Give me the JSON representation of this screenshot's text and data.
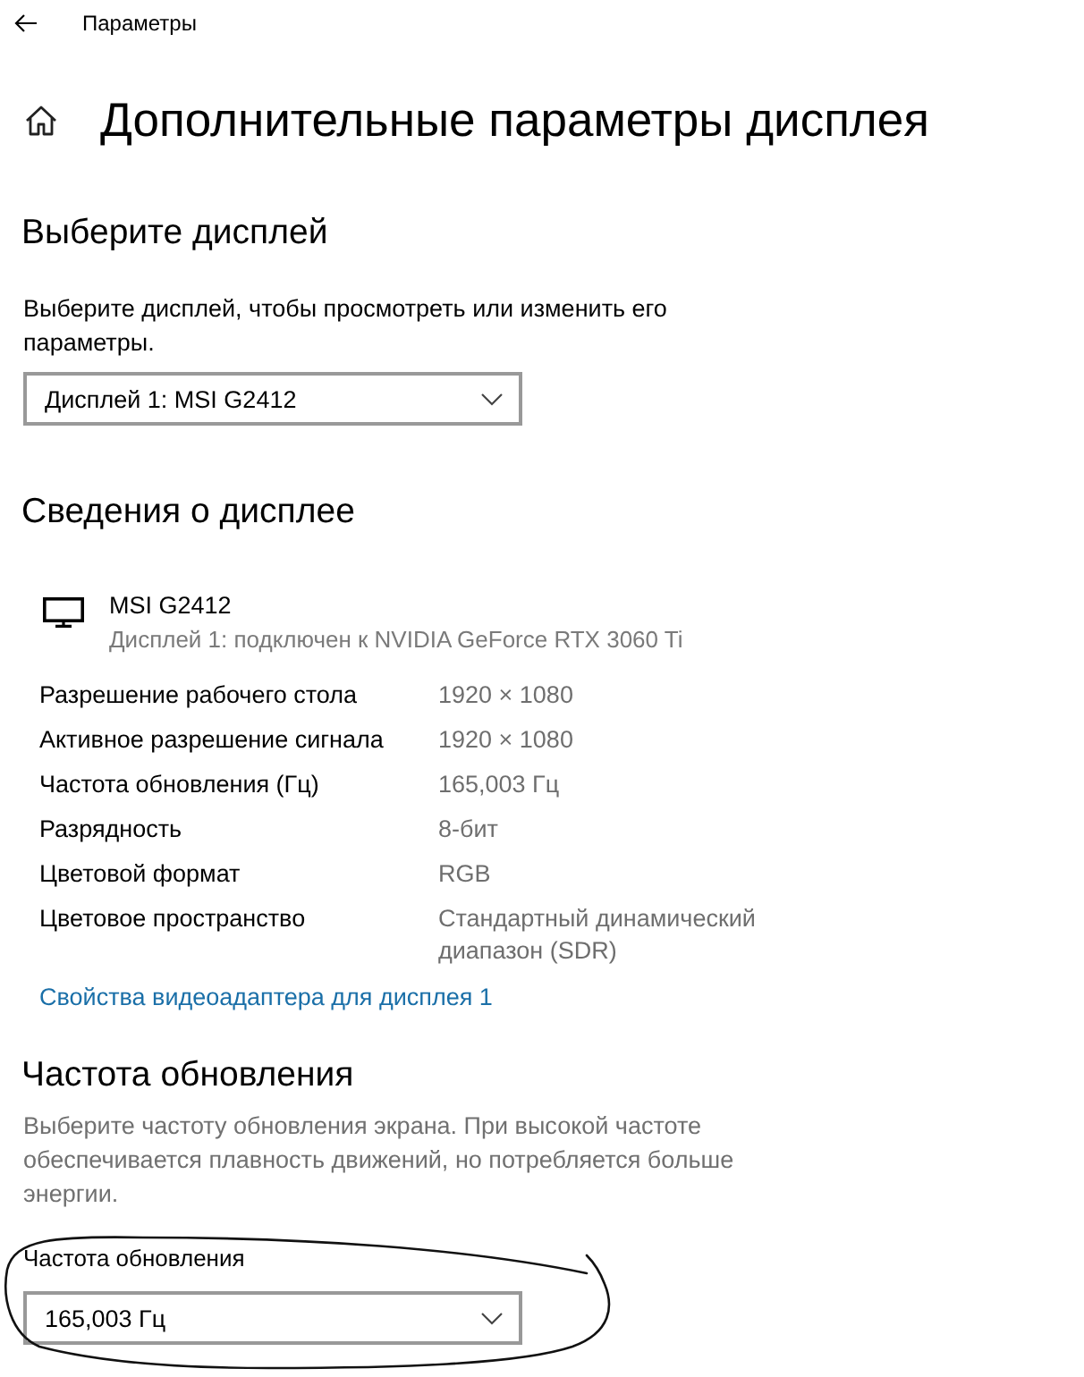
{
  "window": {
    "title": "Параметры"
  },
  "page": {
    "title": "Дополнительные параметры дисплея"
  },
  "select_display": {
    "heading": "Выберите дисплей",
    "description": "Выберите дисплей, чтобы просмотреть или изменить его параметры.",
    "dropdown": {
      "value": "Дисплей 1: MSI G2412"
    }
  },
  "display_info": {
    "heading": "Сведения о дисплее",
    "monitor": {
      "name": "MSI G2412",
      "subtitle": "Дисплей 1: подключен к NVIDIA GeForce RTX 3060 Ti"
    },
    "rows": [
      {
        "label": "Разрешение рабочего стола",
        "value": "1920 × 1080"
      },
      {
        "label": "Активное разрешение сигнала",
        "value": "1920 × 1080"
      },
      {
        "label": "Частота обновления (Гц)",
        "value": "165,003 Гц"
      },
      {
        "label": "Разрядность",
        "value": "8-бит"
      },
      {
        "label": "Цветовой формат",
        "value": "RGB"
      },
      {
        "label": "Цветовое пространство",
        "value": "Стандартный динамический диапазон (SDR)"
      }
    ],
    "link": "Свойства видеоадаптера для дисплея 1"
  },
  "refresh_rate": {
    "heading": "Частота обновления",
    "description": "Выберите частоту обновления экрана. При высокой частоте обеспечивается плавность движений, но потребляется больше энергии.",
    "dropdown": {
      "label": "Частота обновления",
      "value": "165,003 Гц"
    }
  },
  "annotation": {
    "kind": "freehand-ellipse"
  }
}
